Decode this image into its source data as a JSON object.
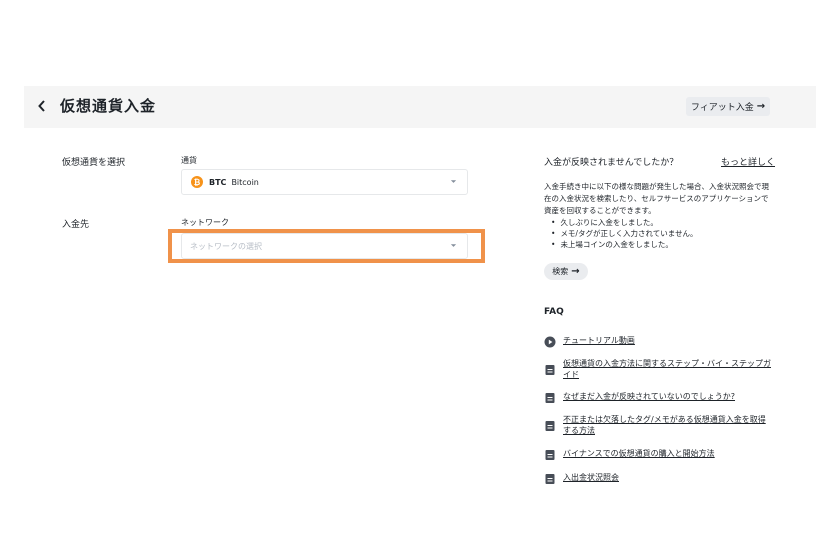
{
  "header": {
    "title": "仮想通貨入金",
    "fiat_button_label": "フィアット入金",
    "arrow": "→"
  },
  "form": {
    "select_crypto_label": "仮想通貨を選択",
    "currency_field_label": "通貨",
    "coin_symbol": "BTC",
    "coin_name": "Bitcoin",
    "coin_glyph": "₿",
    "deposit_to_label": "入金先",
    "network_field_label": "ネットワーク",
    "network_placeholder": "ネットワークの選択"
  },
  "help": {
    "title": "入金が反映されませんでしたか？",
    "more_link": "もっと詳しく",
    "description": "入金手続き中に以下の様な問題が発生した場合、入金状況照会で現在の入金状況を検索したり、セルフサービスのアプリケーションで資産を回収することができます。",
    "issues": [
      "久しぶりに入金をしました。",
      "メモ/タグが正しく入力されていません。",
      "未上場コインの入金をしました。"
    ],
    "search_button_label": "検索",
    "arrow": "→"
  },
  "faq": {
    "title": "FAQ",
    "items": [
      {
        "icon": "play-icon",
        "text": "チュートリアル動画"
      },
      {
        "icon": "document-icon",
        "text": "仮想通貨の入金方法に関するステップ・バイ・ステップガイド"
      },
      {
        "icon": "document-icon",
        "text": "なぜまだ入金が反映されていないのでしょうか?"
      },
      {
        "icon": "document-icon",
        "text": "不正または欠落したタグ/メモがある仮想通貨入金を取得する方法"
      },
      {
        "icon": "document-icon",
        "text": "バイナンスでの仮想通貨の購入と開始方法"
      },
      {
        "icon": "document-icon",
        "text": "入出金状況照会"
      }
    ]
  },
  "colors": {
    "highlight": "#f0924a",
    "bitcoin": "#f7931a",
    "header_bg": "#f5f5f5"
  }
}
